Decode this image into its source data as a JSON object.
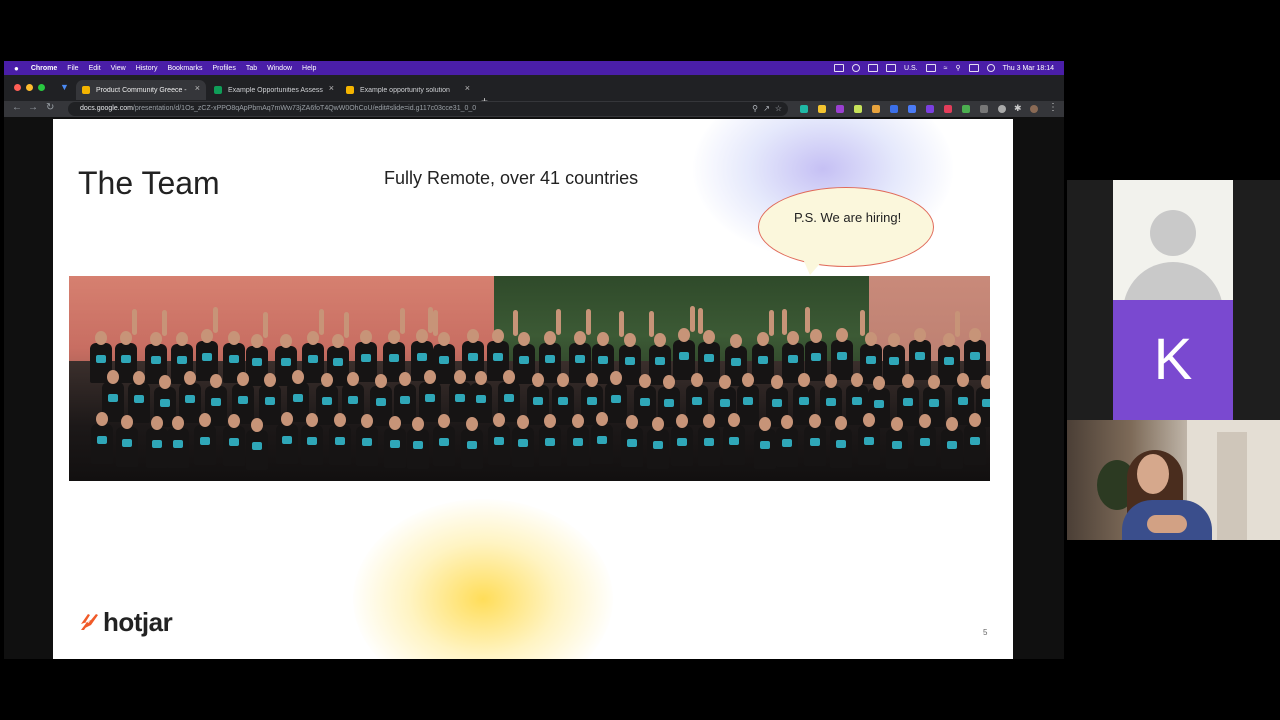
{
  "menubar": {
    "items": [
      "Chrome",
      "File",
      "Edit",
      "View",
      "History",
      "Bookmarks",
      "Profiles",
      "Tab",
      "Window",
      "Help"
    ],
    "locale": "U.S.",
    "clock": "Thu 3 Mar  18:14"
  },
  "tabs": [
    {
      "label": "Product Community Greece -",
      "color": "#f4b400"
    },
    {
      "label": "Example Opportunities Assess",
      "color": "#0f9d58"
    },
    {
      "label": "Example opportunity solution",
      "color": "#f4b400"
    }
  ],
  "omnibox": {
    "host": "docs.google.com",
    "path": "/presentation/d/1Os_zCZ-xPPO8qApPbmAq7mWw73jZA6foT4QwW0OhCoU/edit#slide=id.g117c03cce31_0_0"
  },
  "slide": {
    "title": "The Team",
    "subtitle": "Fully Remote, over 41 countries",
    "callout": "P.S. We are hiring!",
    "brand": "hotjar",
    "number": "5"
  },
  "call": {
    "participant_initial": "K"
  },
  "colors": {
    "menubar": "#4a1ea8",
    "avatar_tile": "#7a49d0",
    "brand_accent": "#f05a28"
  }
}
